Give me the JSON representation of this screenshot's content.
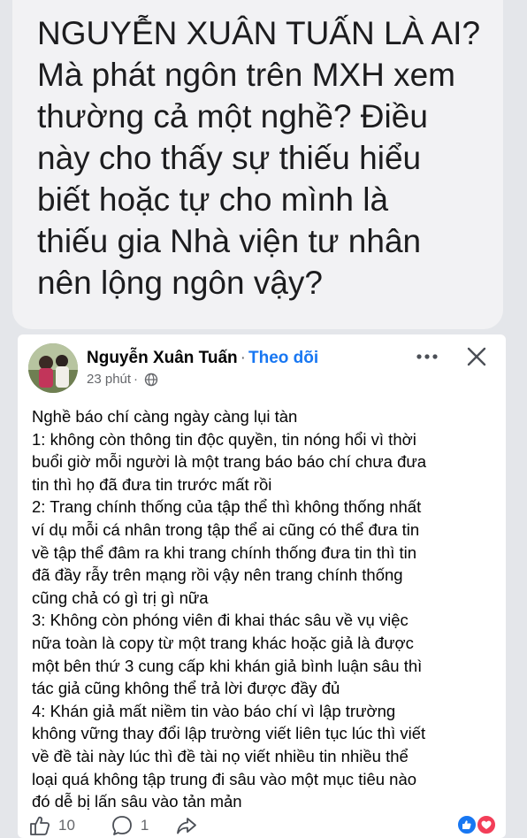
{
  "caption": {
    "lines": [
      "NGUYỄN XUÂN TUẤN LÀ AI?",
      "Mà phát ngôn trên MXH xem",
      "thường cả một nghề? Điều",
      "này cho thấy sự thiếu hiểu",
      "biết hoặc tự cho mình là",
      "thiếu gia Nhà viện tư nhân",
      "nên lộng ngôn vậy?"
    ]
  },
  "post": {
    "author": "Nguyễn Xuân Tuấn",
    "separator": "·",
    "follow_label": "Theo dõi",
    "time": "23 phút",
    "meta_separator": "·",
    "body_lines": [
      "Nghề báo chí càng ngày càng lụi tàn",
      "1: không còn thông tin độc quyền, tin nóng hổi vì thời",
      "buổi giờ mỗi người là một trang báo báo chí chưa đưa",
      "tin thì họ đã đưa tin trước mất rồi",
      "2: Trang chính thống của tập thể thì không thống nhất",
      "ví dụ mỗi cá nhân trong tập thể ai cũng có thể đưa tin",
      "về tập thể đâm ra khi trang chính thống đưa tin thì tin",
      "đã đầy rẫy trên mạng rồi vậy nên trang chính thống",
      "cũng chả có gì trị gì nữa",
      "3: Không còn phóng viên đi khai thác sâu về vụ việc",
      "nữa toàn là copy từ một trang khác hoặc giả là được",
      "một bên thứ 3 cung cấp khi khán giả bình luận sâu thì",
      "tác giả cũng không thể trả lời được đầy đủ",
      "4: Khán giả mất niềm tin vào báo chí vì lập trường",
      "không vững thay đổi lập trường viết liên tục lúc thì viết",
      "về đề tài này lúc thì đề tài nọ viết nhiều tin nhiều thể",
      "loại quá không tập trung đi sâu vào một mục tiêu nào",
      "đó dễ bị lấn sâu vào tản mản"
    ],
    "actions": {
      "like_count": "10",
      "comment_count": "1"
    }
  },
  "colors": {
    "link_blue": "#1877f2",
    "meta_gray": "#65676b",
    "background": "#e4e6ea"
  },
  "icons": [
    "globe-icon",
    "more-icon",
    "close-icon",
    "like-icon",
    "comment-icon",
    "share-icon"
  ]
}
